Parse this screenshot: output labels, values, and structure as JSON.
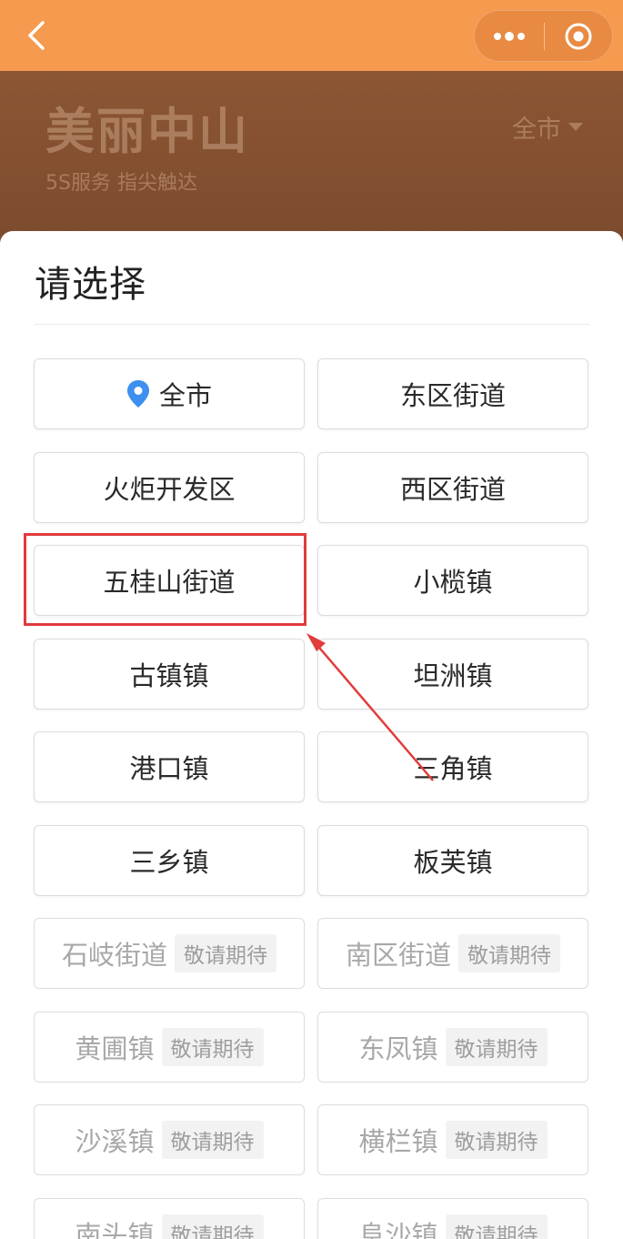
{
  "navbar": {
    "back_icon": "chevron-left-icon",
    "more_icon": "more-dots-icon",
    "target_icon": "target-circle-icon"
  },
  "banner": {
    "title": "美丽中山",
    "subtitle": "5S服务 指尖触达",
    "city_selector": "全市"
  },
  "sheet": {
    "title": "请选择",
    "options": [
      {
        "label": "全市",
        "icon": "location-pin-icon",
        "badge": "",
        "disabled": false
      },
      {
        "label": "东区街道",
        "badge": "",
        "disabled": false
      },
      {
        "label": "火炬开发区",
        "badge": "",
        "disabled": false
      },
      {
        "label": "西区街道",
        "badge": "",
        "disabled": false
      },
      {
        "label": "五桂山街道",
        "badge": "",
        "disabled": false
      },
      {
        "label": "小榄镇",
        "badge": "",
        "disabled": false
      },
      {
        "label": "古镇镇",
        "badge": "",
        "disabled": false
      },
      {
        "label": "坦洲镇",
        "badge": "",
        "disabled": false
      },
      {
        "label": "港口镇",
        "badge": "",
        "disabled": false
      },
      {
        "label": "三角镇",
        "badge": "",
        "disabled": false
      },
      {
        "label": "三乡镇",
        "badge": "",
        "disabled": false
      },
      {
        "label": "板芙镇",
        "badge": "",
        "disabled": false
      },
      {
        "label": "石岐街道",
        "badge": "敬请期待",
        "disabled": true
      },
      {
        "label": "南区街道",
        "badge": "敬请期待",
        "disabled": true
      },
      {
        "label": "黄圃镇",
        "badge": "敬请期待",
        "disabled": true
      },
      {
        "label": "东凤镇",
        "badge": "敬请期待",
        "disabled": true
      },
      {
        "label": "沙溪镇",
        "badge": "敬请期待",
        "disabled": true
      },
      {
        "label": "横栏镇",
        "badge": "敬请期待",
        "disabled": true
      },
      {
        "label": "南头镇",
        "badge": "敬请期待",
        "disabled": true
      },
      {
        "label": "阜沙镇",
        "badge": "敬请期待",
        "disabled": true
      }
    ]
  },
  "colors": {
    "navbar": "#f59a4e",
    "annotation_red": "#e23b3b",
    "pin_blue": "#3d8ff0"
  }
}
